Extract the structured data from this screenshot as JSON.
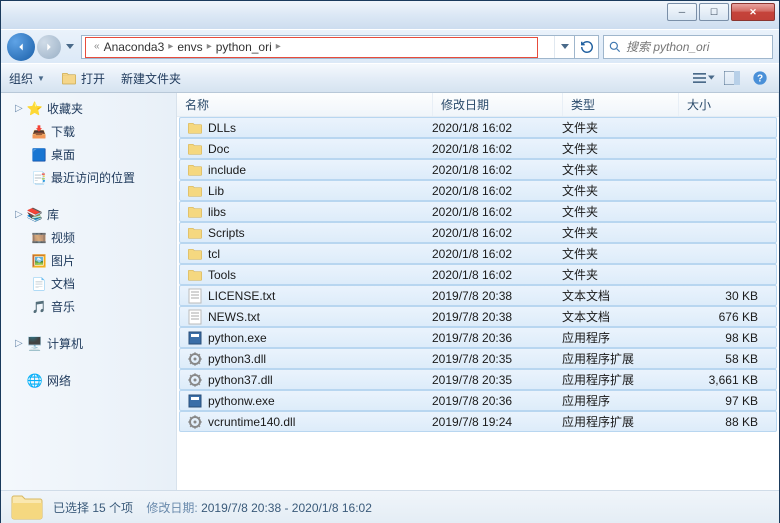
{
  "breadcrumbs": [
    "Anaconda3",
    "envs",
    "python_ori"
  ],
  "search": {
    "placeholder": "搜索 python_ori"
  },
  "toolbar": {
    "organize": "组织",
    "open": "打开",
    "newfolder": "新建文件夹"
  },
  "columns": {
    "name": "名称",
    "date": "修改日期",
    "type": "类型",
    "size": "大小"
  },
  "sidebar": {
    "favorites": {
      "label": "收藏夹",
      "items": [
        {
          "label": "下载",
          "icon": "download"
        },
        {
          "label": "桌面",
          "icon": "desktop"
        },
        {
          "label": "最近访问的位置",
          "icon": "recent"
        }
      ]
    },
    "libraries": {
      "label": "库",
      "items": [
        {
          "label": "视频",
          "icon": "video"
        },
        {
          "label": "图片",
          "icon": "picture"
        },
        {
          "label": "文档",
          "icon": "document"
        },
        {
          "label": "音乐",
          "icon": "music"
        }
      ]
    },
    "computer": {
      "label": "计算机"
    },
    "network": {
      "label": "网络"
    }
  },
  "files": [
    {
      "name": "DLLs",
      "date": "2020/1/8 16:02",
      "type": "文件夹",
      "size": "",
      "icon": "folder"
    },
    {
      "name": "Doc",
      "date": "2020/1/8 16:02",
      "type": "文件夹",
      "size": "",
      "icon": "folder"
    },
    {
      "name": "include",
      "date": "2020/1/8 16:02",
      "type": "文件夹",
      "size": "",
      "icon": "folder"
    },
    {
      "name": "Lib",
      "date": "2020/1/8 16:02",
      "type": "文件夹",
      "size": "",
      "icon": "folder"
    },
    {
      "name": "libs",
      "date": "2020/1/8 16:02",
      "type": "文件夹",
      "size": "",
      "icon": "folder"
    },
    {
      "name": "Scripts",
      "date": "2020/1/8 16:02",
      "type": "文件夹",
      "size": "",
      "icon": "folder"
    },
    {
      "name": "tcl",
      "date": "2020/1/8 16:02",
      "type": "文件夹",
      "size": "",
      "icon": "folder"
    },
    {
      "name": "Tools",
      "date": "2020/1/8 16:02",
      "type": "文件夹",
      "size": "",
      "icon": "folder"
    },
    {
      "name": "LICENSE.txt",
      "date": "2019/7/8 20:38",
      "type": "文本文档",
      "size": "30 KB",
      "icon": "text"
    },
    {
      "name": "NEWS.txt",
      "date": "2019/7/8 20:38",
      "type": "文本文档",
      "size": "676 KB",
      "icon": "text"
    },
    {
      "name": "python.exe",
      "date": "2019/7/8 20:36",
      "type": "应用程序",
      "size": "98 KB",
      "icon": "exe"
    },
    {
      "name": "python3.dll",
      "date": "2019/7/8 20:35",
      "type": "应用程序扩展",
      "size": "58 KB",
      "icon": "dll"
    },
    {
      "name": "python37.dll",
      "date": "2019/7/8 20:35",
      "type": "应用程序扩展",
      "size": "3,661 KB",
      "icon": "dll"
    },
    {
      "name": "pythonw.exe",
      "date": "2019/7/8 20:36",
      "type": "应用程序",
      "size": "97 KB",
      "icon": "exe"
    },
    {
      "name": "vcruntime140.dll",
      "date": "2019/7/8 19:24",
      "type": "应用程序扩展",
      "size": "88 KB",
      "icon": "dll"
    }
  ],
  "status": {
    "selected": "已选择 15 个项",
    "detail_label": "修改日期:",
    "detail_value": "2019/7/8 20:38 - 2020/1/8 16:02"
  }
}
